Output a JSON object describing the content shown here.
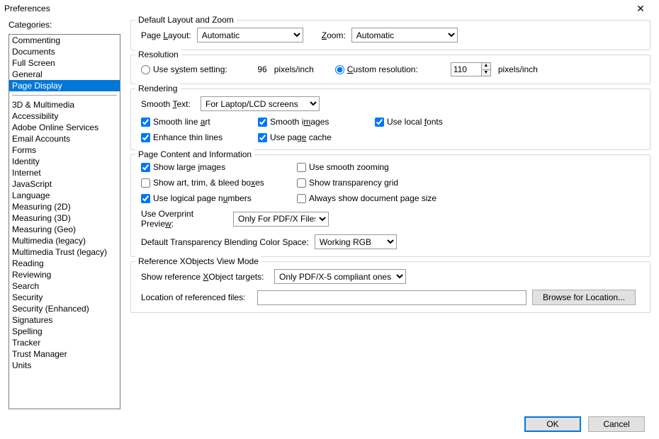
{
  "window": {
    "title": "Preferences"
  },
  "categoriesLabel": "Categories:",
  "categoriesTop": [
    "Commenting",
    "Documents",
    "Full Screen",
    "General",
    "Page Display"
  ],
  "categoriesBottom": [
    "3D & Multimedia",
    "Accessibility",
    "Adobe Online Services",
    "Email Accounts",
    "Forms",
    "Identity",
    "Internet",
    "JavaScript",
    "Language",
    "Measuring (2D)",
    "Measuring (3D)",
    "Measuring (Geo)",
    "Multimedia (legacy)",
    "Multimedia Trust (legacy)",
    "Reading",
    "Reviewing",
    "Search",
    "Security",
    "Security (Enhanced)",
    "Signatures",
    "Spelling",
    "Tracker",
    "Trust Manager",
    "Units"
  ],
  "selectedCategory": "Page Display",
  "groups": {
    "layout": {
      "title": "Default Layout and Zoom",
      "pageLayoutLabel": "Page Layout:",
      "pageLayoutValue": "Automatic",
      "zoomLabel": "Zoom:",
      "zoomValue": "Automatic"
    },
    "resolution": {
      "title": "Resolution",
      "useSystem": "Use system setting:",
      "systemVal": "96",
      "unit": "pixels/inch",
      "custom": "Custom resolution:",
      "customVal": "110"
    },
    "rendering": {
      "title": "Rendering",
      "smoothTextLabel": "Smooth Text:",
      "smoothTextValue": "For Laptop/LCD screens",
      "smoothLineArt": "Smooth line art",
      "smoothImages": "Smooth images",
      "useLocalFonts": "Use local fonts",
      "enhanceThin": "Enhance thin lines",
      "usePageCache": "Use page cache"
    },
    "content": {
      "title": "Page Content and Information",
      "showLarge": "Show large images",
      "smoothZoom": "Use smooth zooming",
      "showArt": "Show art, trim, & bleed boxes",
      "showGrid": "Show transparency grid",
      "useLogical": "Use logical page numbers",
      "alwaysShow": "Always show document page size",
      "overprintLabel": "Use Overprint Preview:",
      "overprintValue": "Only For PDF/X Files",
      "defaultTransLabel": "Default Transparency Blending Color Space:",
      "defaultTransValue": "Working RGB"
    },
    "xobj": {
      "title": "Reference XObjects View Mode",
      "showRefLabel": "Show reference XObject targets:",
      "showRefValue": "Only PDF/X-5 compliant ones",
      "locationLabel": "Location of referenced files:",
      "locationValue": "",
      "browse": "Browse for Location..."
    }
  },
  "buttons": {
    "ok": "OK",
    "cancel": "Cancel"
  }
}
